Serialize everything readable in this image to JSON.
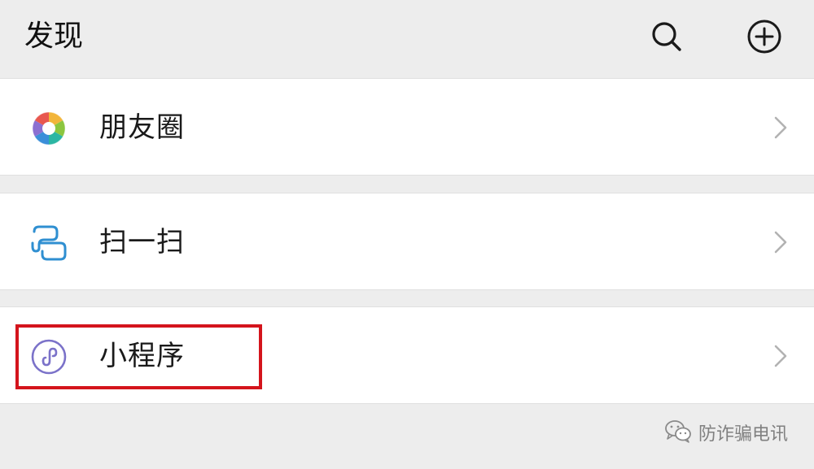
{
  "header": {
    "title": "发现",
    "search_icon": "search-icon",
    "add_icon": "add-circle-icon"
  },
  "items": [
    {
      "label": "朋友圈",
      "icon": "moments-aperture-icon"
    },
    {
      "label": "扫一扫",
      "icon": "scan-icon"
    },
    {
      "label": "小程序",
      "icon": "mini-program-icon"
    }
  ],
  "highlight": {
    "target": "小程序",
    "color": "#d4141c"
  },
  "watermark": {
    "text": "防诈骗电讯",
    "icon": "wechat-icon"
  },
  "colors": {
    "background": "#ededed",
    "row_background": "#ffffff",
    "scan_blue": "#2f8fd1",
    "mini_program_purple": "#7b72c9",
    "chevron_gray": "#b2b2b2"
  }
}
